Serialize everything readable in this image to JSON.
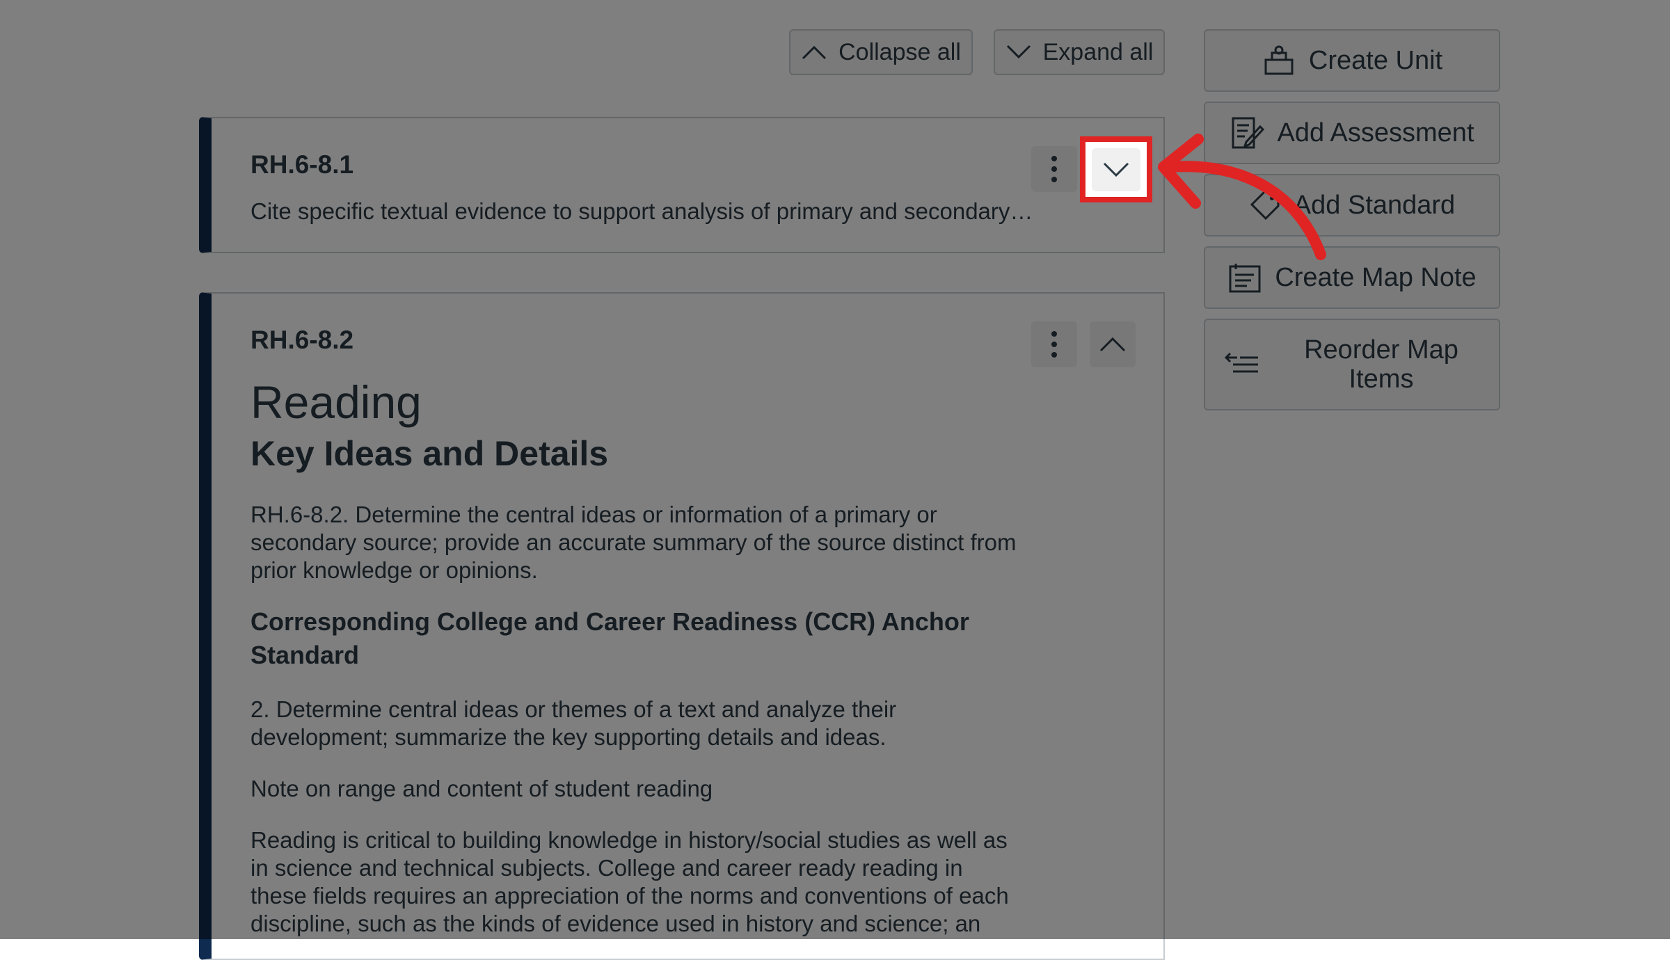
{
  "toolbar": {
    "collapse_all": "Collapse all",
    "expand_all": "Expand all"
  },
  "actions": [
    {
      "label": "Create Unit",
      "icon": "unit-icon"
    },
    {
      "label": "Add Assessment",
      "icon": "assessment-icon"
    },
    {
      "label": "Add Standard",
      "icon": "standard-tag-icon"
    },
    {
      "label": "Create Map Note",
      "icon": "map-note-icon"
    },
    {
      "label": "Reorder Map Items",
      "icon": "reorder-icon"
    }
  ],
  "standards": [
    {
      "code": "RH.6-8.1",
      "summary": "Cite specific textual evidence to support analysis of primary and secondary…",
      "state": "collapsed"
    },
    {
      "code": "RH.6-8.2",
      "state": "expanded",
      "heading": "Reading",
      "subheading": "Key Ideas and Details",
      "paragraph1": "RH.6-8.2. Determine the central ideas or information of a primary or secondary source; provide an accurate summary of the source distinct from prior knowledge or opinions.",
      "ccr_heading": "Corresponding College and Career Readiness (CCR) Anchor Standard",
      "paragraph2": "2. Determine central ideas or themes of a text and analyze their development; summarize the key supporting details and ideas.",
      "note_label": "Note on range and content of student reading",
      "paragraph3": "Reading is critical to building knowledge in history/social studies as well as in science and technical subjects. College and career ready reading in these fields requires an appreciation of the norms and conventions of each discipline, such as the kinds of evidence used in history and science; an"
    }
  ],
  "colors": {
    "accent_bar": "#0f2b4f",
    "highlight": "#e02424",
    "overlay": "rgba(0,0,0,0.5)"
  }
}
